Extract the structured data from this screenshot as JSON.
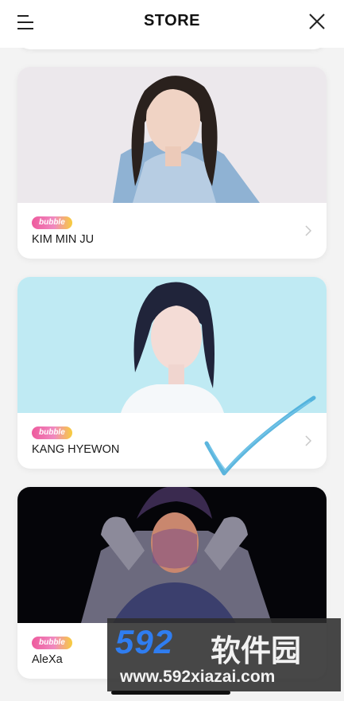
{
  "header": {
    "title": "STORE",
    "menu_icon": "hamburger-menu-icon",
    "close_icon": "close-icon"
  },
  "cards": [
    {
      "badge": "bubble",
      "name": "KIM MIN JU"
    },
    {
      "badge": "bubble",
      "name": "KANG HYEWON"
    },
    {
      "badge": "bubble",
      "name": "AleXa"
    }
  ],
  "watermark": {
    "logo": "592",
    "cn": "软件园",
    "url": "www.592xiazai.com"
  },
  "colors": {
    "accent_pink": "#ee5a9d",
    "accent_yellow": "#f7cd3c",
    "checkmark": "#3fa9d8"
  }
}
